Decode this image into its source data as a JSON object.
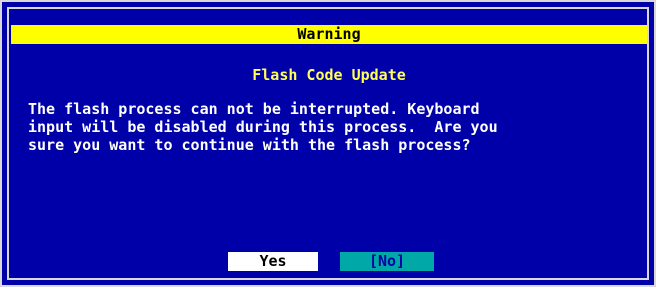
{
  "dialog": {
    "title": "Warning",
    "subtitle": "Flash Code Update",
    "message_lines": [
      "The flash process can not be interrupted. Keyboard",
      "input will be disabled during this process.  Are you",
      "sure you want to continue with the flash process?"
    ],
    "buttons": {
      "yes_label": "Yes",
      "no_label": "[No]"
    },
    "selected_button": "No"
  },
  "colors": {
    "background": "#0000a8",
    "title_bar": "#ffff00",
    "subtitle_text": "#ffff54",
    "body_text": "#ffffff",
    "yes_button_bg": "#ffffff",
    "no_button_bg": "#00a8a8",
    "border": "#d8d8d8"
  }
}
